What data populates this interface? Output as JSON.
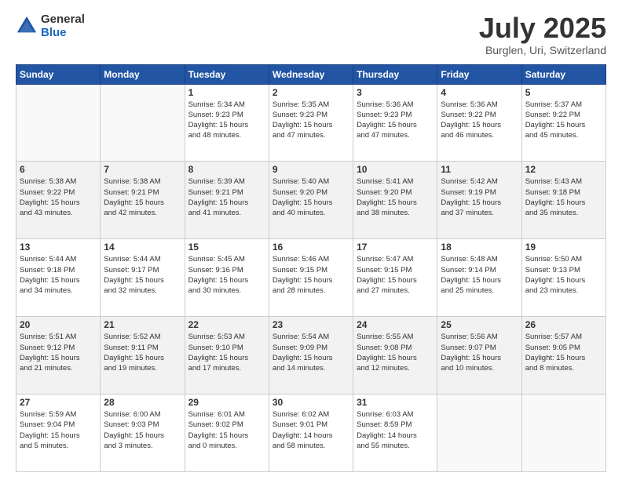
{
  "header": {
    "logo_general": "General",
    "logo_blue": "Blue",
    "title": "July 2025",
    "location": "Burglen, Uri, Switzerland"
  },
  "weekdays": [
    "Sunday",
    "Monday",
    "Tuesday",
    "Wednesday",
    "Thursday",
    "Friday",
    "Saturday"
  ],
  "weeks": [
    [
      {
        "day": "",
        "empty": true
      },
      {
        "day": "",
        "empty": true
      },
      {
        "day": "1",
        "line1": "Sunrise: 5:34 AM",
        "line2": "Sunset: 9:23 PM",
        "line3": "Daylight: 15 hours",
        "line4": "and 48 minutes."
      },
      {
        "day": "2",
        "line1": "Sunrise: 5:35 AM",
        "line2": "Sunset: 9:23 PM",
        "line3": "Daylight: 15 hours",
        "line4": "and 47 minutes."
      },
      {
        "day": "3",
        "line1": "Sunrise: 5:36 AM",
        "line2": "Sunset: 9:23 PM",
        "line3": "Daylight: 15 hours",
        "line4": "and 47 minutes."
      },
      {
        "day": "4",
        "line1": "Sunrise: 5:36 AM",
        "line2": "Sunset: 9:22 PM",
        "line3": "Daylight: 15 hours",
        "line4": "and 46 minutes."
      },
      {
        "day": "5",
        "line1": "Sunrise: 5:37 AM",
        "line2": "Sunset: 9:22 PM",
        "line3": "Daylight: 15 hours",
        "line4": "and 45 minutes."
      }
    ],
    [
      {
        "day": "6",
        "line1": "Sunrise: 5:38 AM",
        "line2": "Sunset: 9:22 PM",
        "line3": "Daylight: 15 hours",
        "line4": "and 43 minutes."
      },
      {
        "day": "7",
        "line1": "Sunrise: 5:38 AM",
        "line2": "Sunset: 9:21 PM",
        "line3": "Daylight: 15 hours",
        "line4": "and 42 minutes."
      },
      {
        "day": "8",
        "line1": "Sunrise: 5:39 AM",
        "line2": "Sunset: 9:21 PM",
        "line3": "Daylight: 15 hours",
        "line4": "and 41 minutes."
      },
      {
        "day": "9",
        "line1": "Sunrise: 5:40 AM",
        "line2": "Sunset: 9:20 PM",
        "line3": "Daylight: 15 hours",
        "line4": "and 40 minutes."
      },
      {
        "day": "10",
        "line1": "Sunrise: 5:41 AM",
        "line2": "Sunset: 9:20 PM",
        "line3": "Daylight: 15 hours",
        "line4": "and 38 minutes."
      },
      {
        "day": "11",
        "line1": "Sunrise: 5:42 AM",
        "line2": "Sunset: 9:19 PM",
        "line3": "Daylight: 15 hours",
        "line4": "and 37 minutes."
      },
      {
        "day": "12",
        "line1": "Sunrise: 5:43 AM",
        "line2": "Sunset: 9:18 PM",
        "line3": "Daylight: 15 hours",
        "line4": "and 35 minutes."
      }
    ],
    [
      {
        "day": "13",
        "line1": "Sunrise: 5:44 AM",
        "line2": "Sunset: 9:18 PM",
        "line3": "Daylight: 15 hours",
        "line4": "and 34 minutes."
      },
      {
        "day": "14",
        "line1": "Sunrise: 5:44 AM",
        "line2": "Sunset: 9:17 PM",
        "line3": "Daylight: 15 hours",
        "line4": "and 32 minutes."
      },
      {
        "day": "15",
        "line1": "Sunrise: 5:45 AM",
        "line2": "Sunset: 9:16 PM",
        "line3": "Daylight: 15 hours",
        "line4": "and 30 minutes."
      },
      {
        "day": "16",
        "line1": "Sunrise: 5:46 AM",
        "line2": "Sunset: 9:15 PM",
        "line3": "Daylight: 15 hours",
        "line4": "and 28 minutes."
      },
      {
        "day": "17",
        "line1": "Sunrise: 5:47 AM",
        "line2": "Sunset: 9:15 PM",
        "line3": "Daylight: 15 hours",
        "line4": "and 27 minutes."
      },
      {
        "day": "18",
        "line1": "Sunrise: 5:48 AM",
        "line2": "Sunset: 9:14 PM",
        "line3": "Daylight: 15 hours",
        "line4": "and 25 minutes."
      },
      {
        "day": "19",
        "line1": "Sunrise: 5:50 AM",
        "line2": "Sunset: 9:13 PM",
        "line3": "Daylight: 15 hours",
        "line4": "and 23 minutes."
      }
    ],
    [
      {
        "day": "20",
        "line1": "Sunrise: 5:51 AM",
        "line2": "Sunset: 9:12 PM",
        "line3": "Daylight: 15 hours",
        "line4": "and 21 minutes."
      },
      {
        "day": "21",
        "line1": "Sunrise: 5:52 AM",
        "line2": "Sunset: 9:11 PM",
        "line3": "Daylight: 15 hours",
        "line4": "and 19 minutes."
      },
      {
        "day": "22",
        "line1": "Sunrise: 5:53 AM",
        "line2": "Sunset: 9:10 PM",
        "line3": "Daylight: 15 hours",
        "line4": "and 17 minutes."
      },
      {
        "day": "23",
        "line1": "Sunrise: 5:54 AM",
        "line2": "Sunset: 9:09 PM",
        "line3": "Daylight: 15 hours",
        "line4": "and 14 minutes."
      },
      {
        "day": "24",
        "line1": "Sunrise: 5:55 AM",
        "line2": "Sunset: 9:08 PM",
        "line3": "Daylight: 15 hours",
        "line4": "and 12 minutes."
      },
      {
        "day": "25",
        "line1": "Sunrise: 5:56 AM",
        "line2": "Sunset: 9:07 PM",
        "line3": "Daylight: 15 hours",
        "line4": "and 10 minutes."
      },
      {
        "day": "26",
        "line1": "Sunrise: 5:57 AM",
        "line2": "Sunset: 9:05 PM",
        "line3": "Daylight: 15 hours",
        "line4": "and 8 minutes."
      }
    ],
    [
      {
        "day": "27",
        "line1": "Sunrise: 5:59 AM",
        "line2": "Sunset: 9:04 PM",
        "line3": "Daylight: 15 hours",
        "line4": "and 5 minutes."
      },
      {
        "day": "28",
        "line1": "Sunrise: 6:00 AM",
        "line2": "Sunset: 9:03 PM",
        "line3": "Daylight: 15 hours",
        "line4": "and 3 minutes."
      },
      {
        "day": "29",
        "line1": "Sunrise: 6:01 AM",
        "line2": "Sunset: 9:02 PM",
        "line3": "Daylight: 15 hours",
        "line4": "and 0 minutes."
      },
      {
        "day": "30",
        "line1": "Sunrise: 6:02 AM",
        "line2": "Sunset: 9:01 PM",
        "line3": "Daylight: 14 hours",
        "line4": "and 58 minutes."
      },
      {
        "day": "31",
        "line1": "Sunrise: 6:03 AM",
        "line2": "Sunset: 8:59 PM",
        "line3": "Daylight: 14 hours",
        "line4": "and 55 minutes."
      },
      {
        "day": "",
        "empty": true
      },
      {
        "day": "",
        "empty": true
      }
    ]
  ]
}
